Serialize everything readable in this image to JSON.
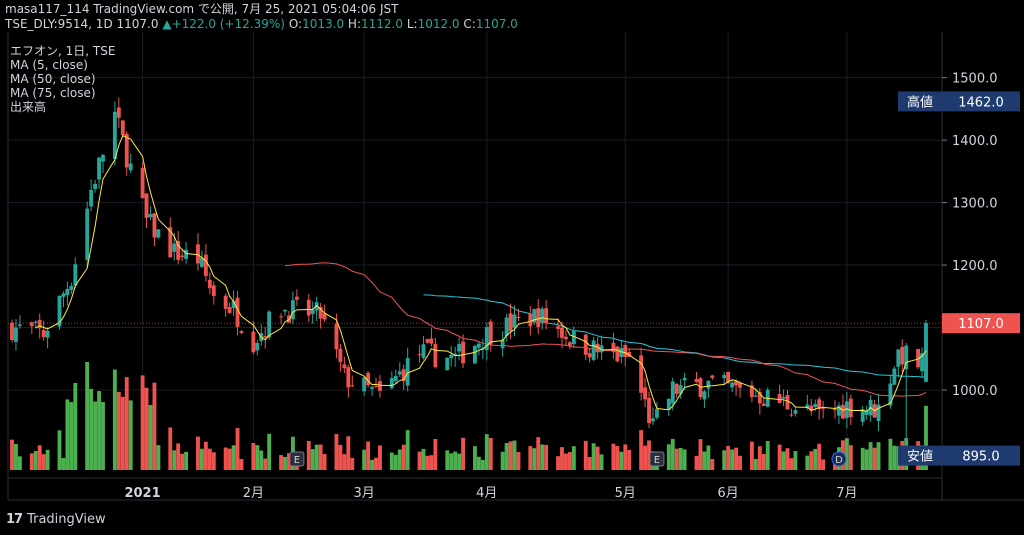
{
  "header": {
    "line1": "masa117_114 TradingView.com で公開, 7月 25, 2021 05:04:06 JST",
    "symbol": "TSE_DLY:9514, 1D",
    "last": "1107.0",
    "change": "+122.0 (+12.39%)",
    "ohlc": {
      "o_label": "O:",
      "o": "1013.0",
      "h_label": "H:",
      "h": "1112.0",
      "l_label": "L:",
      "l": "1012.0",
      "c_label": "C:",
      "c": "1107.0"
    }
  },
  "legend": {
    "symbol": "エフオン, 1日, TSE",
    "ma5": "MA (5, close)",
    "ma50": "MA (50, close)",
    "ma75": "MA (75, close)",
    "volume": "出来高"
  },
  "price_badges": {
    "high": {
      "label": "高値",
      "value": "1462.0",
      "price": 1462
    },
    "current": {
      "value": "1107.0",
      "price": 1107
    },
    "low": {
      "label": "安値",
      "value": "895.0",
      "price": 895
    }
  },
  "event_markers": [
    {
      "label": "E",
      "date": "2021-02-12"
    },
    {
      "label": "E",
      "date": "2021-05-14"
    },
    {
      "label": "D",
      "date": "2021-06-29"
    }
  ],
  "colors": {
    "up": "#26a69a",
    "down": "#ef5350",
    "up_vol": "#4caf50",
    "down_vol": "#ef5350",
    "ma5": "#ffeb3b",
    "ma50": "#ef5350",
    "ma75": "#26c6da",
    "current_badge": "#ef5350",
    "badge_dark": "#1e3a6e"
  },
  "brand": {
    "name": "TradingView",
    "logo": "17"
  },
  "chart_data": {
    "type": "candlestick",
    "yaxis": {
      "ticks": [
        1000,
        1100,
        1200,
        1300,
        1400,
        1500
      ],
      "tick_labels": [
        "1000.0",
        "1100.0",
        "1200.0",
        "1300.0",
        "1400.0",
        "1500.0"
      ],
      "range": [
        895,
        1560
      ]
    },
    "xaxis": {
      "ticks": [
        {
          "date": "2021-01-04",
          "label": "2021"
        },
        {
          "date": "2021-02-01",
          "label": "2月"
        },
        {
          "date": "2021-03-01",
          "label": "3月"
        },
        {
          "date": "2021-04-01",
          "label": "4月"
        },
        {
          "date": "2021-05-06",
          "label": "5月"
        },
        {
          "date": "2021-06-01",
          "label": "6月"
        },
        {
          "date": "2021-07-01",
          "label": "7月"
        }
      ],
      "range": [
        "2020-12-02",
        "2021-07-21"
      ]
    },
    "grid": true,
    "keypoints": [
      [
        "2020-12-02",
        1100
      ],
      [
        "2020-12-10",
        1090
      ],
      [
        "2020-12-17",
        1180
      ],
      [
        "2020-12-22",
        1320
      ],
      [
        "2020-12-28",
        1440
      ],
      [
        "2021-01-05",
        1270
      ],
      [
        "2021-01-12",
        1220
      ],
      [
        "2021-01-18",
        1210
      ],
      [
        "2021-01-22",
        1150
      ],
      [
        "2021-01-27",
        1130
      ],
      [
        "2021-02-01",
        1080
      ],
      [
        "2021-02-08",
        1130
      ],
      [
        "2021-02-18",
        1120
      ],
      [
        "2021-02-24",
        1020
      ],
      [
        "2021-03-05",
        990
      ],
      [
        "2021-03-15",
        1060
      ],
      [
        "2021-03-24",
        1050
      ],
      [
        "2021-04-01",
        1090
      ],
      [
        "2021-04-14",
        1120
      ],
      [
        "2021-04-23",
        1080
      ],
      [
        "2021-04-30",
        1060
      ],
      [
        "2021-05-07",
        1050
      ],
      [
        "2021-05-13",
        940
      ],
      [
        "2021-05-18",
        1000
      ],
      [
        "2021-05-27",
        1010
      ],
      [
        "2021-06-07",
        995
      ],
      [
        "2021-06-15",
        980
      ],
      [
        "2021-06-24",
        960
      ],
      [
        "2021-07-01",
        975
      ],
      [
        "2021-07-09",
        970
      ],
      [
        "2021-07-14",
        1060
      ],
      [
        "2021-07-20",
        1040
      ],
      [
        "2021-07-21",
        1107
      ]
    ],
    "last_bar": {
      "date": "2021-07-21",
      "o": 1013,
      "h": 1112,
      "l": 1012,
      "c": 1107
    }
  }
}
